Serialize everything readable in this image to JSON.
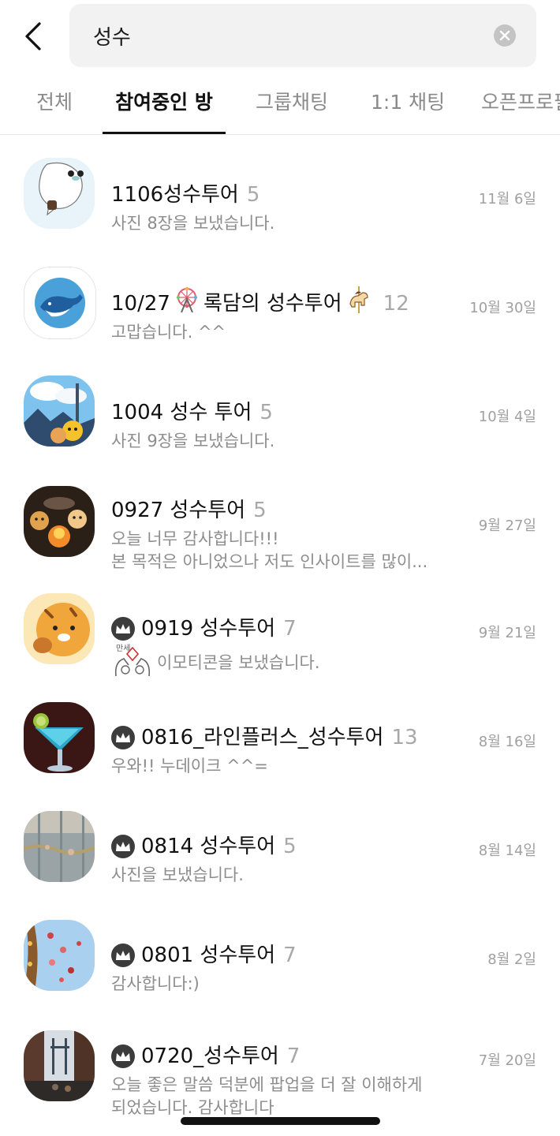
{
  "search": {
    "value": "성수"
  },
  "tabs": [
    {
      "label": "전체",
      "active": false
    },
    {
      "label": "참여중인 방",
      "active": true
    },
    {
      "label": "그룹채팅",
      "active": false
    },
    {
      "label": "1:1 채팅",
      "active": false
    },
    {
      "label": "오픈프로필",
      "active": false
    }
  ],
  "rooms": [
    {
      "title": "1106성수투어",
      "count": "5",
      "preview": [
        "사진 8장을 보냈습니다."
      ],
      "date": "11월 6일",
      "host": false
    },
    {
      "title_prefix": "10/27",
      "title_middle": "록담의 성수투어",
      "count": "12",
      "preview": [
        "고맙습니다. ^^"
      ],
      "date": "10월 30일",
      "host": false
    },
    {
      "title": "1004 성수 투어",
      "count": "5",
      "preview": [
        "사진 9장을 보냈습니다."
      ],
      "date": "10월 4일",
      "host": false
    },
    {
      "title": "0927 성수투어",
      "count": "5",
      "preview": [
        "오늘 너무 감사합니다!!!",
        "본 목적은 아니었으나 저도 인사이트를 많이..."
      ],
      "date": "9월 27일",
      "host": false
    },
    {
      "title": "0919 성수투어",
      "count": "7",
      "preview": [
        "이모티콘을 보냈습니다."
      ],
      "date": "9월 21일",
      "host": true
    },
    {
      "title": "0816_라인플러스_성수투어",
      "count": "13",
      "preview": [
        "우와!! 누데이크 ^^="
      ],
      "date": "8월 16일",
      "host": true
    },
    {
      "title": "0814 성수투어",
      "count": "5",
      "preview": [
        "사진을 보냈습니다."
      ],
      "date": "8월 14일",
      "host": true
    },
    {
      "title": "0801 성수투어",
      "count": "7",
      "preview": [
        "감사합니다:)"
      ],
      "date": "8월 2일",
      "host": true
    },
    {
      "title": "0720_성수투어",
      "count": "7",
      "preview": [
        "오늘 좋은 말씀 덕분에 팝업을 더 잘 이해하게",
        "되었습니다. 감사합니다"
      ],
      "date": "7월 20일",
      "host": true
    }
  ],
  "sticker_text": "만세",
  "colors": {
    "text_primary": "#111111",
    "text_secondary": "#8d8d8d",
    "count": "#a8a8a8",
    "search_bg": "#f2f2f2",
    "crown_bg": "#3c3c3c"
  }
}
